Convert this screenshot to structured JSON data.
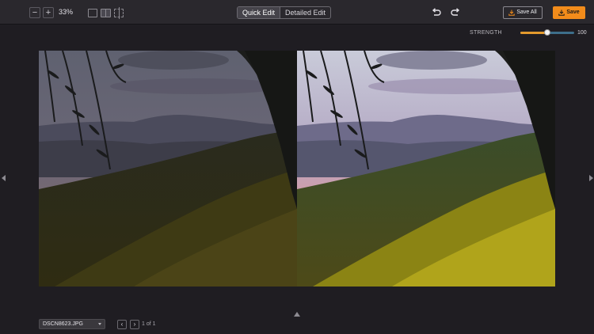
{
  "toolbar": {
    "zoom_out_label": "−",
    "zoom_in_label": "+",
    "zoom_level": "33%",
    "view_modes": [
      "single-view-icon",
      "split-view-icon",
      "compare-view-icon"
    ],
    "active_view_mode": "split-view-icon",
    "tabs": [
      {
        "label": "Quick Edit",
        "active": true
      },
      {
        "label": "Detailed Edit",
        "active": false
      }
    ],
    "undo_icon": "undo-icon",
    "redo_icon": "redo-icon",
    "save_all_label": "Save All",
    "save_label": "Save"
  },
  "strength": {
    "label": "STRENGTH",
    "value": "100",
    "fraction": 1.0
  },
  "footer": {
    "file_name": "DSCN8623.JPG",
    "prev_label": "‹",
    "next_label": "›",
    "page_text": "1 of 1"
  },
  "colors": {
    "accent": "#f28c1b",
    "slider_track": "#3d6e8a",
    "slider_fill": "#e39a2d",
    "background": "#1f1d22",
    "toolbar": "#2a282d"
  }
}
